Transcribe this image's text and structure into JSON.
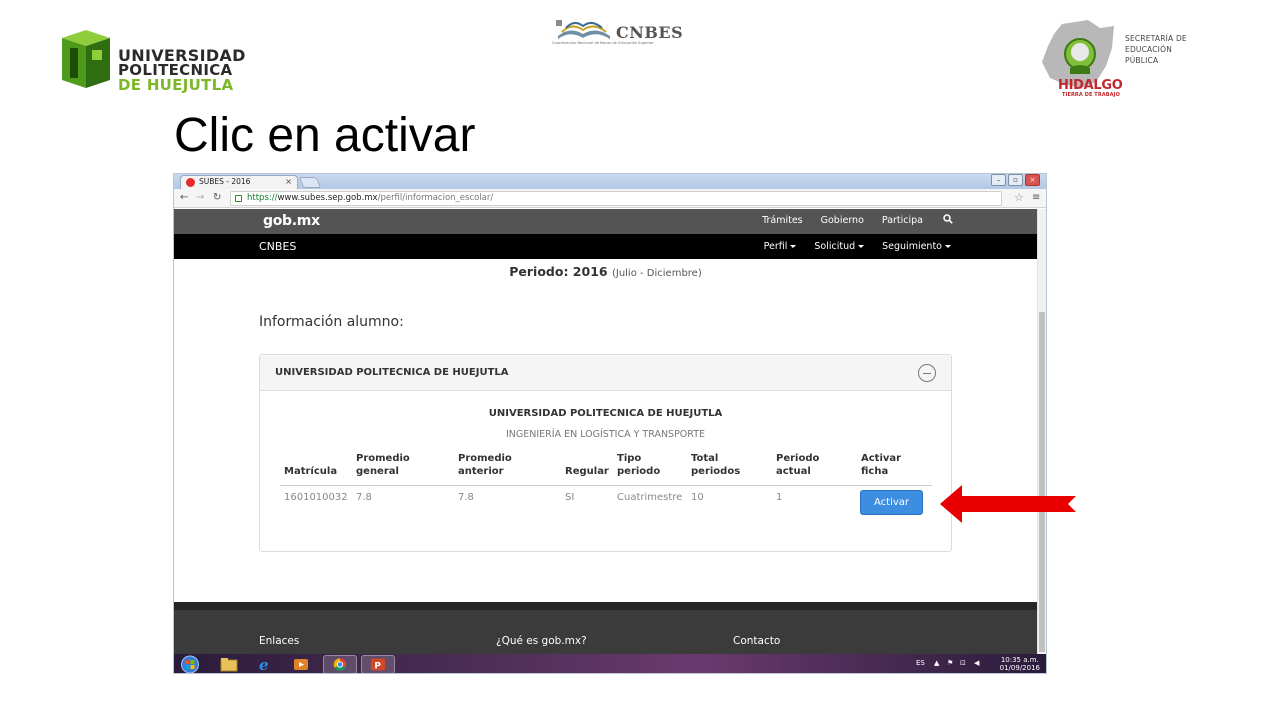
{
  "slide": {
    "title": "Clic en activar",
    "logo_upn": {
      "line1": "UNIVERSIDAD",
      "line2": "POLITECNICA",
      "line3": "DE HUEJUTLA"
    },
    "logo_cnbes": {
      "name": "CNBES",
      "subtitle": "Coordinación Nacional de Becas de Educación Superior"
    },
    "logo_hidalgo": {
      "name": "HIDALGO",
      "tagline": "TIERRA DE TRABAJO",
      "secretaria": "SECRETARÍA DE EDUCACIÓN PÚBLICA"
    }
  },
  "browser": {
    "tab_title": "SUBES - 2016",
    "url_scheme": "https://",
    "url_host": "www.subes.sep.gob.mx",
    "url_path": "/perfil/informacion_escolar/"
  },
  "gob_nav": {
    "brand": "gob.mx",
    "links": [
      "Trámites",
      "Gobierno",
      "Participa"
    ]
  },
  "cnbes_nav": {
    "brand": "CNBES",
    "links": [
      "Perfil",
      "Solicitud",
      "Seguimiento"
    ]
  },
  "page": {
    "periodo_label": "Periodo: 2016",
    "periodo_range": "(Julio - Diciembre)",
    "info_title": "Información alumno:",
    "panel_title": "UNIVERSIDAD POLITECNICA DE HUEJUTLA",
    "school": "UNIVERSIDAD POLITECNICA DE HUEJUTLA",
    "career": "INGENIERÍA EN LOGÍSTICA Y TRANSPORTE",
    "table": {
      "headers": [
        {
          "l1": "",
          "l2": "Matrícula"
        },
        {
          "l1": "Promedio",
          "l2": "general"
        },
        {
          "l1": "Promedio",
          "l2": "anterior"
        },
        {
          "l1": "",
          "l2": "Regular"
        },
        {
          "l1": "Tipo",
          "l2": "periodo"
        },
        {
          "l1": "Total",
          "l2": "periodos"
        },
        {
          "l1": "Periodo",
          "l2": "actual"
        },
        {
          "l1": "Activar",
          "l2": "ficha"
        }
      ],
      "row": [
        "1601010032",
        "7.8",
        "7.8",
        "SI",
        "Cuatrimestre",
        "10",
        "1"
      ],
      "action_label": "Activar"
    }
  },
  "footer": {
    "links": [
      "Enlaces",
      "¿Qué es gob.mx?",
      "Contacto"
    ]
  },
  "taskbar": {
    "language": "ES",
    "time": "10:35 a.m.",
    "date": "01/09/2016"
  },
  "colors": {
    "accent_button": "#3d8ee0",
    "arrow": "#e80000",
    "gob_bar": "#545454",
    "cnbes_bar": "#000000"
  }
}
